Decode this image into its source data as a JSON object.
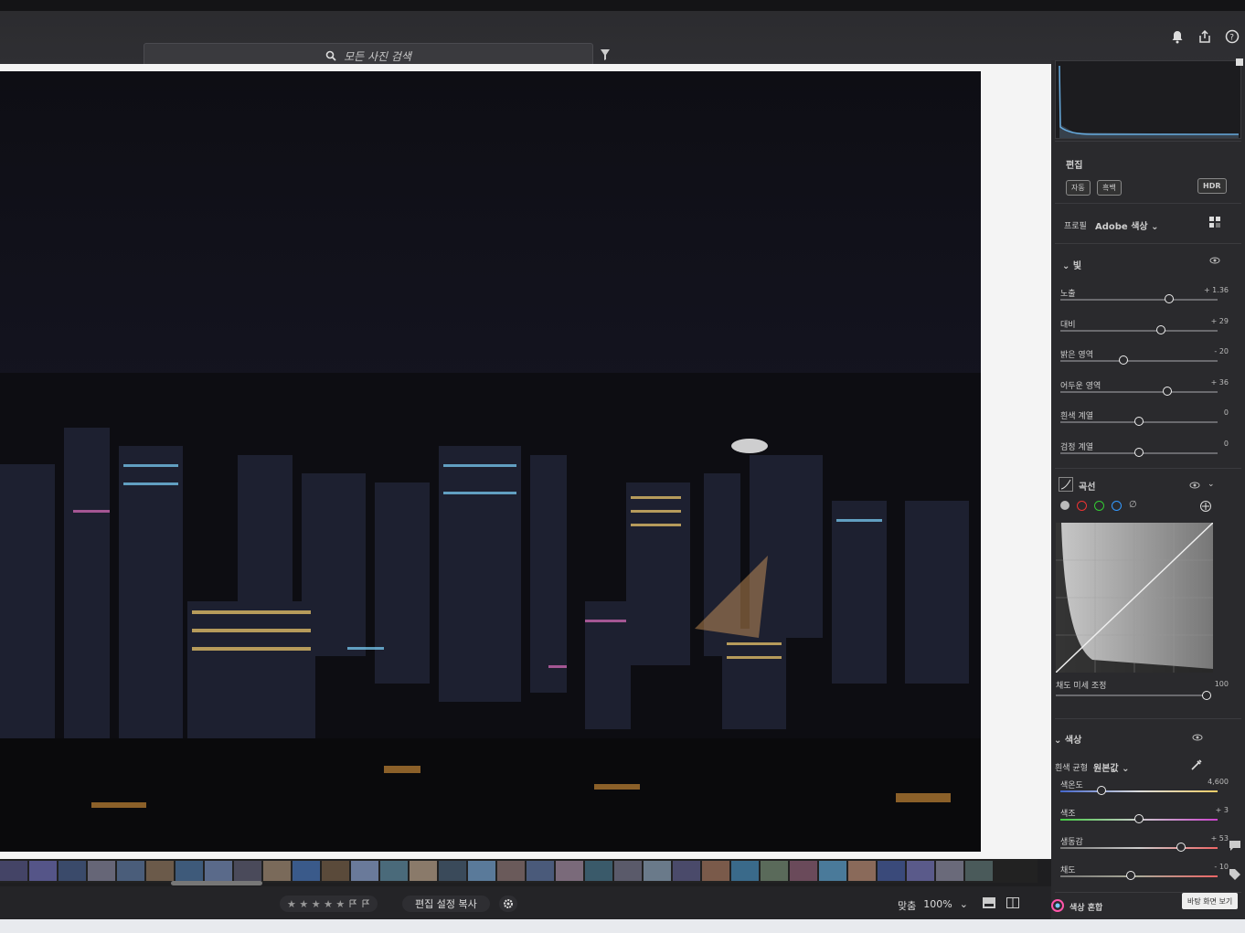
{
  "search": {
    "placeholder": "모든 사진 검색"
  },
  "edit": {
    "title": "편집",
    "auto_label": "자동",
    "bw_label": "흑백",
    "hdr_label": "HDR",
    "profile_label": "프로필",
    "profile_value": "Adobe 색상"
  },
  "light": {
    "title": "빛",
    "sliders": [
      {
        "label": "노출",
        "value": "+ 1.36",
        "level": 0.69
      },
      {
        "label": "대비",
        "value": "+ 29",
        "level": 0.64
      },
      {
        "label": "밝은 영역",
        "value": "- 20",
        "level": 0.4
      },
      {
        "label": "어두운 영역",
        "value": "+ 36",
        "level": 0.68
      },
      {
        "label": "흰색 계열",
        "value": "0",
        "level": 0.5
      },
      {
        "label": "검정 계열",
        "value": "0",
        "level": 0.5
      }
    ]
  },
  "curve": {
    "title": "곡선",
    "refine_label": "채도 미세 조정",
    "refine_value": "100",
    "refine_level": 1.0
  },
  "color": {
    "title": "색상",
    "wb_label": "흰색 균형",
    "wb_value": "원본값",
    "sliders": [
      {
        "label": "색온도",
        "value": "4,600",
        "level": 0.26
      },
      {
        "label": "색조",
        "value": "+ 3",
        "level": 0.5
      },
      {
        "label": "생동감",
        "value": "+ 53",
        "level": 0.77
      },
      {
        "label": "채도",
        "value": "- 10",
        "level": 0.45
      }
    ],
    "mix_label": "색상 혼합"
  },
  "bottom": {
    "stars": "★ ★ ★ ★ ★",
    "copy_label": "편집 설정 복사",
    "fit_label": "맞춤",
    "zoom_label": "100%"
  },
  "tooltip": "바탕 화면 보기",
  "colors": {
    "accent": "#e8e8e8",
    "panel": "#2a2a2d"
  }
}
